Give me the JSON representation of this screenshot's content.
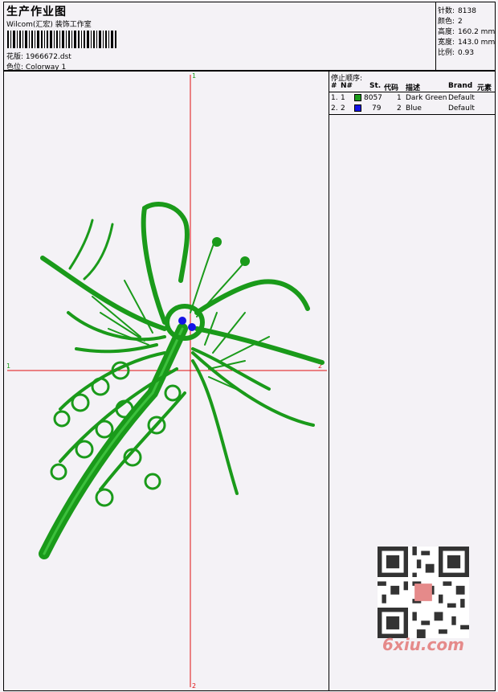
{
  "header": {
    "title": "生产作业图",
    "studio": "Wilcom(汇宏) 装饰工作室",
    "design_label": "花版:",
    "design_value": "1966672.dst",
    "colorway_label": "色位:",
    "colorway_value": "Colorway 1"
  },
  "stats": [
    {
      "label": "针数:",
      "value": "8138"
    },
    {
      "label": "颜色:",
      "value": "2"
    },
    {
      "label": "高度:",
      "value": "160.2 mm"
    },
    {
      "label": "宽度:",
      "value": "143.0 mm"
    },
    {
      "label": "比例:",
      "value": "0.93"
    }
  ],
  "sequence": {
    "heading": "停止顺序:",
    "columns": [
      "#",
      "N#",
      "St.",
      "代码",
      "描述",
      "Brand",
      "元素"
    ],
    "rows": [
      {
        "num": "1.",
        "n": "1",
        "st": "8057",
        "code": "1",
        "desc": "Dark Green",
        "brand": "Default",
        "color": "#1a9a1a"
      },
      {
        "num": "2.",
        "n": "2",
        "st": "79",
        "code": "2",
        "desc": "Blue",
        "brand": "Default",
        "color": "#1414e6"
      }
    ]
  },
  "axis_markers": {
    "top": "1",
    "bottom": "2",
    "left": "1",
    "right": "2"
  },
  "colors": {
    "thread_green": "#1a9a1a",
    "thread_blue": "#1414e6",
    "axis_red": "#e01010"
  },
  "watermark": "6xiu.com"
}
